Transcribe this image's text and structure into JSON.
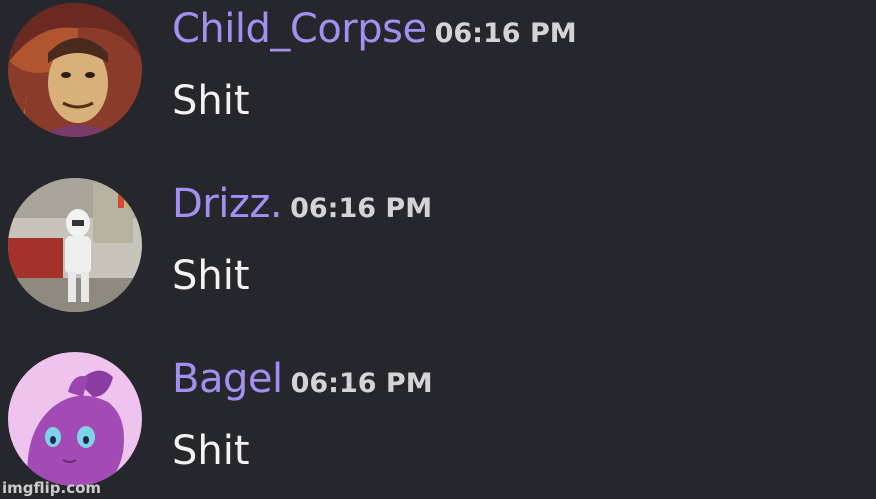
{
  "messages": [
    {
      "username": "Child_Corpse",
      "timestamp": "06:16 PM",
      "text": "Shit",
      "avatar_icon": "avatar-child-corpse",
      "name_color": "#a48ff0"
    },
    {
      "username": "Drizz.",
      "timestamp": "06:16 PM",
      "text": "Shit",
      "avatar_icon": "avatar-drizz",
      "name_color": "#a48ff0"
    },
    {
      "username": "Bagel",
      "timestamp": "06:16 PM",
      "text": "Shit",
      "avatar_icon": "avatar-bagel",
      "name_color": "#a48ff0"
    }
  ],
  "watermark": "imgflip.com",
  "colors": {
    "background": "#26272d",
    "username": "#a48ff0",
    "timestamp": "#d4d4d8",
    "text": "#f2f2f2"
  }
}
